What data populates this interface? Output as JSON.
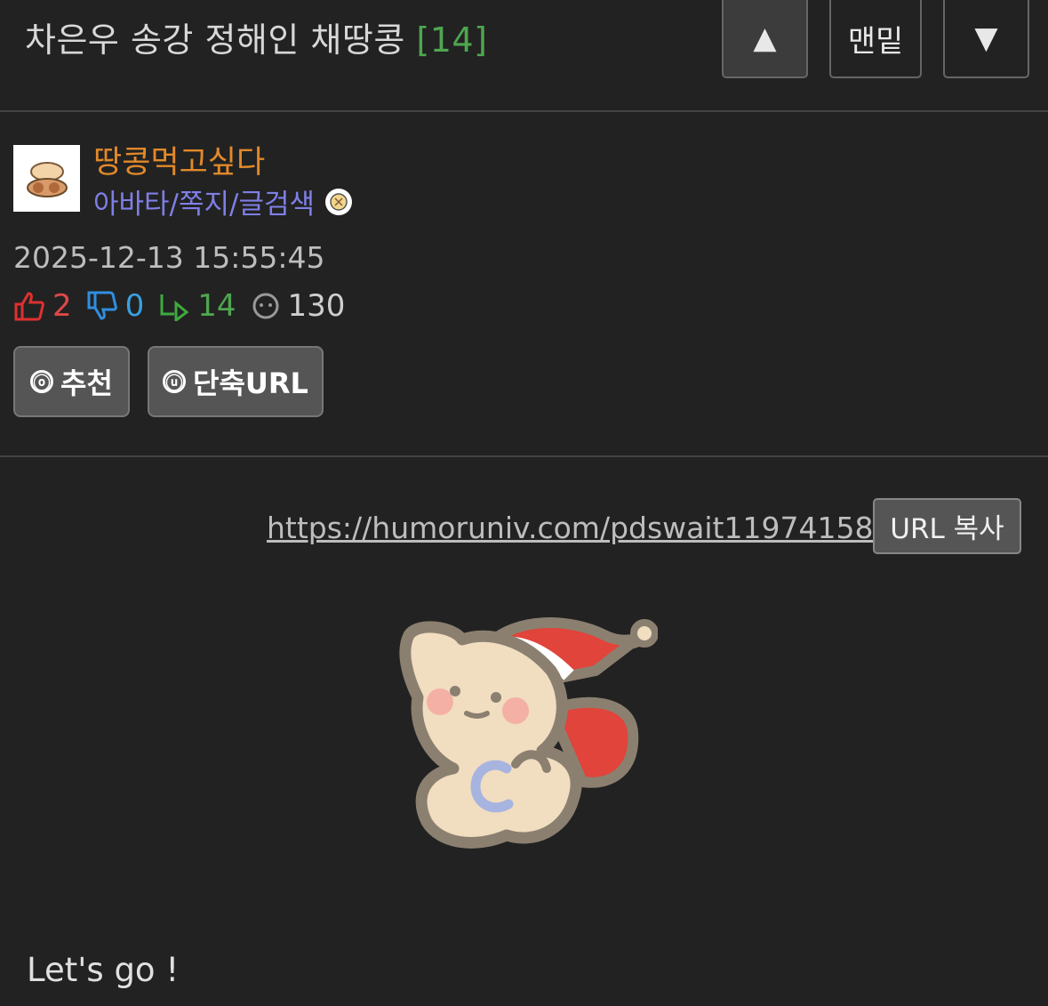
{
  "header": {
    "title": "차은우 송강 정해인 채땅콩",
    "comment_count": "[14]",
    "nav": {
      "up": "▲",
      "bottom": "맨밑",
      "down": "▼"
    }
  },
  "author": {
    "nickname": "땅콩먹고싶다",
    "links": "아바타/쪽지/글검색",
    "date": "2025-12-13 15:55:45",
    "stats": {
      "likes": "2",
      "dislikes": "0",
      "replies": "14",
      "views": "130"
    },
    "buttons": {
      "recommend": "추천",
      "recommend_icon": "ⓞ",
      "short_url": "단축URL",
      "short_url_icon": "ⓤ"
    }
  },
  "content": {
    "url": "https://humoruniv.com/pdswait11974158",
    "copy_label": "URL 복사",
    "body_text": "Let's go !"
  },
  "colors": {
    "background": "#222222",
    "nickname": "#e2892a",
    "links": "#7f7fe8",
    "count": "#4fa64f",
    "like": "#e04848",
    "dislike": "#3aa0e0",
    "reply": "#4fa64f"
  },
  "icons": [
    "peanut-avatar-icon",
    "badge-icon",
    "thumbs-up-icon",
    "thumbs-down-icon",
    "reply-arrow-icon",
    "views-face-icon",
    "bear-santa-sticker"
  ]
}
